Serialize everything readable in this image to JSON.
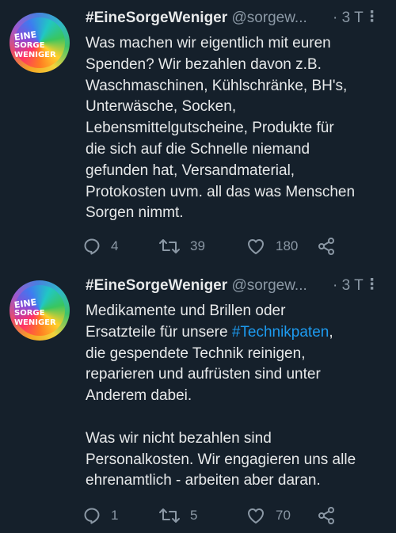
{
  "tweets": [
    {
      "avatar_text": [
        "EINE",
        "SORGE",
        "WENIGER"
      ],
      "name": "#EineSorgeWeniger",
      "handle": "@sorgew...",
      "time": "· 3 T",
      "more_icon": "more-vertical",
      "text_lines": [
        "Was machen wir eigentlich mit euren",
        "Spenden? Wir bezahlen davon z.B.",
        "Waschmaschinen, Kühlschränke, BH's,",
        "Unterwäsche, Socken,",
        "Lebensmittelgutscheine, Produkte für",
        "die sich auf die Schnelle niemand",
        "gefunden hat, Versandmaterial,",
        "Protokosten uvm. all das was Menschen",
        "Sorgen nimmt."
      ],
      "replies": "4",
      "retweets": "39",
      "likes": "180"
    },
    {
      "avatar_text": [
        "EINE",
        "SORGE",
        "WENIGER"
      ],
      "name": "#EineSorgeWeniger",
      "handle": "@sorgew...",
      "time": "· 3 T",
      "more_icon": "more-vertical",
      "text_line1": "Medikamente und Brillen oder",
      "text_line2_prefix": "Ersatzteile für unsere ",
      "hashtag": "#Technikpaten",
      "text_line2_suffix": ",",
      "text_lines_rest": [
        "die gespendete Technik reinigen,",
        "reparieren und aufrüsten sind unter",
        "Anderem dabei.",
        "",
        "Was wir nicht bezahlen sind",
        "Personalkosten. Wir engagieren uns alle",
        "ehrenamtlich - arbeiten aber daran."
      ],
      "replies": "1",
      "retweets": "5",
      "likes": "70"
    }
  ],
  "colors": {
    "background": "#15202b",
    "text": "#e7e9ea",
    "secondary": "#8b98a5",
    "link": "#1d9bf0"
  }
}
